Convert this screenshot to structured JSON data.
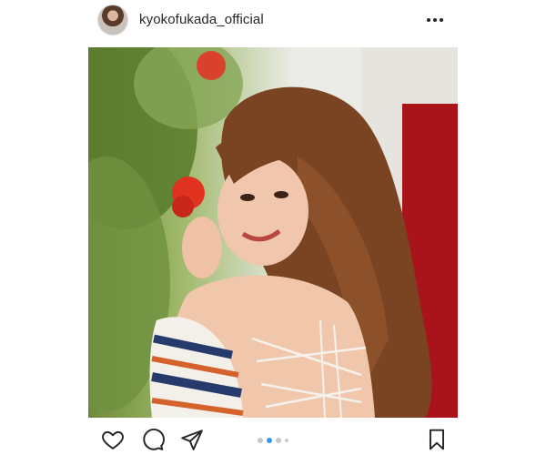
{
  "post": {
    "username": "kyokofukada_official",
    "avatar_icon": "profile-avatar",
    "more_icon": "more-horizontal-icon"
  },
  "actions": {
    "like_icon": "heart-icon",
    "comment_icon": "comment-icon",
    "share_icon": "paper-plane-icon",
    "save_icon": "bookmark-icon"
  },
  "carousel": {
    "total_indicators": 4,
    "active_index": 1
  },
  "colors": {
    "active_dot": "#3897f0",
    "inactive_dot": "#c7c7c7",
    "text": "#262626"
  }
}
